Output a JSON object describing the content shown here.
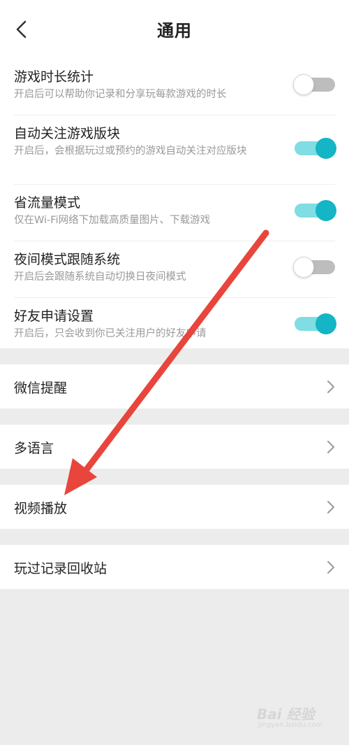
{
  "header": {
    "title": "通用"
  },
  "toggles": [
    {
      "title": "游戏时长统计",
      "desc": "开启后可以帮助你记录和分享玩每款游戏的时长",
      "on": false
    },
    {
      "title": "自动关注游戏版块",
      "desc": "开启后，会根据玩过或预约的游戏自动关注对应版块",
      "on": true
    },
    {
      "title": "省流量模式",
      "desc": "仅在Wi-Fi网络下加载高质量图片、下载游戏",
      "on": true
    },
    {
      "title": "夜间模式跟随系统",
      "desc": "开启后会跟随系统自动切换日夜间模式",
      "on": false
    },
    {
      "title": "好友申请设置",
      "desc": "开启后，只会收到你已关注用户的好友申请",
      "on": true
    }
  ],
  "nav": {
    "wechat": "微信提醒",
    "language": "多语言",
    "video": "视频播放",
    "recycle": "玩过记录回收站"
  },
  "colors": {
    "accent": "#14b5c4",
    "accent_track": "#7fdde3",
    "annotation_arrow": "#e8453c"
  },
  "watermark": {
    "brand": "Bai 经验",
    "sub": "jingyan.baidu.com"
  }
}
